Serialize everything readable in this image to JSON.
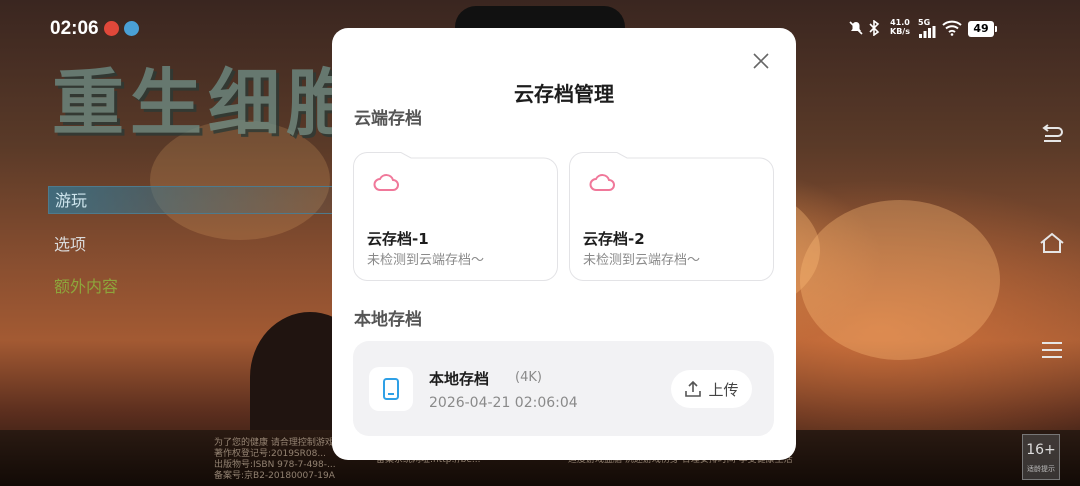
{
  "status_bar": {
    "time": "02:06",
    "network_speed_value": "41.0",
    "network_speed_unit": "KB/s",
    "signal_label": "5G",
    "battery": "49"
  },
  "game": {
    "title": "重生细胞",
    "menu": {
      "play": "游玩",
      "options": "选项",
      "extra": "额外内容"
    },
    "legal_left": "为了您的健康 请合理控制游戏\n著作权登记号:2019SR08...\n出版物号:ISBN 978-7-498-...\n备案号:京B2-20180007-19A",
    "legal_mid": "备案系统网址:http://be...",
    "legal_right": "适度游戏益脑 沉迷游戏伤身 合理安排时间 享受健康生活",
    "age_rating": "16+",
    "age_rating_sub": "适龄提示"
  },
  "dialog": {
    "title": "云存档管理",
    "cloud_section_label": "云端存档",
    "cloud_saves": [
      {
        "name": "云存档-1",
        "status": "未检测到云端存档〜"
      },
      {
        "name": "云存档-2",
        "status": "未检测到云端存档〜"
      }
    ],
    "local_section_label": "本地存档",
    "local_save": {
      "name": "本地存档",
      "size": "(4K)",
      "timestamp": "2026-04-21 02:06:04",
      "upload_label": "上传"
    }
  },
  "colors": {
    "cloud_icon": "#f0789a",
    "phone_icon": "#2fa0e6",
    "dialog_bg": "#ffffff",
    "local_card_bg": "#f2f2f4"
  }
}
